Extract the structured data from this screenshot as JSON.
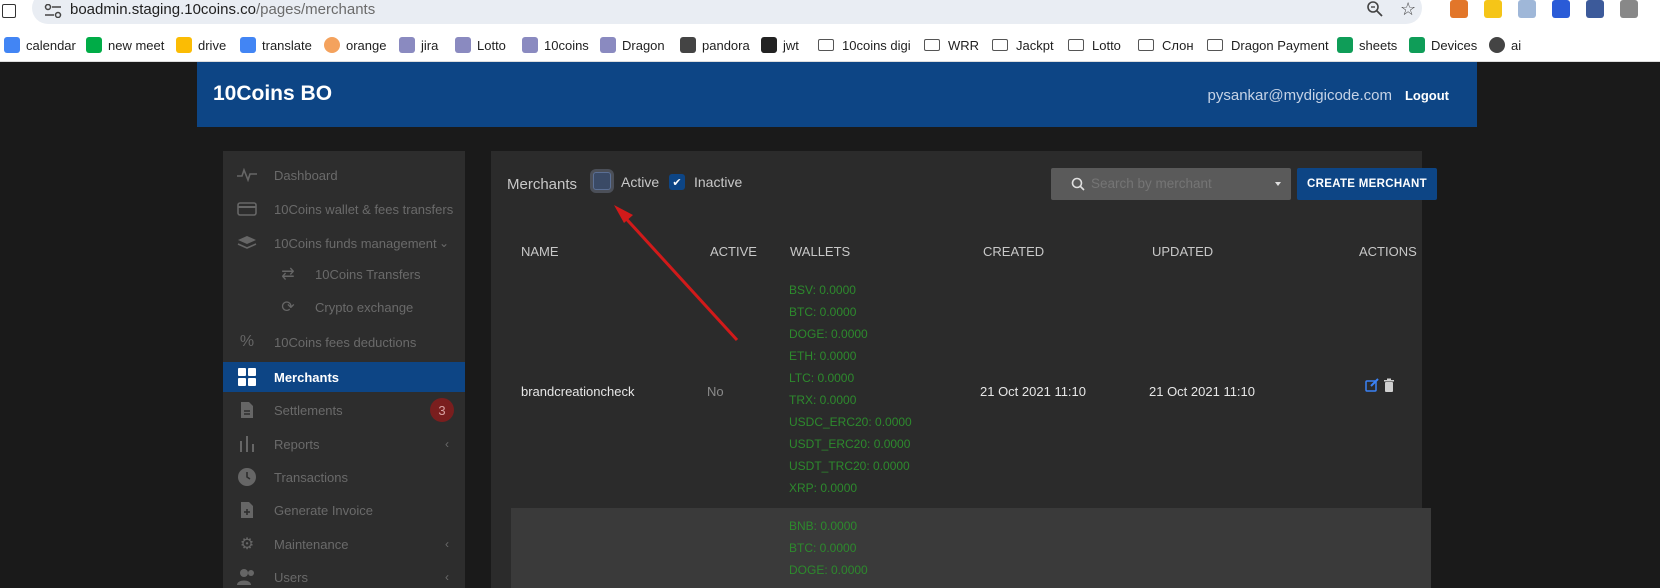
{
  "browser": {
    "url_host": "boadmin.staging.10coins.co",
    "url_path": "/pages/merchants",
    "bookmarks": [
      {
        "label": "calendar",
        "icon": "calendar-icon",
        "color": "#4285f4"
      },
      {
        "label": "new meet",
        "icon": "meet-icon",
        "color": "#00ac47"
      },
      {
        "label": "drive",
        "icon": "drive-icon",
        "color": "#fbbc04"
      },
      {
        "label": "translate",
        "icon": "translate-icon",
        "color": "#4285f4"
      },
      {
        "label": "orange",
        "icon": "orange-icon",
        "color": "#f4a25d"
      },
      {
        "label": "jira",
        "icon": "jira-icon",
        "color": "#8a8ac0"
      },
      {
        "label": "Lotto",
        "icon": "lotto-icon",
        "color": "#8a8ac0"
      },
      {
        "label": "10coins",
        "icon": "10coins-icon",
        "color": "#8a8ac0"
      },
      {
        "label": "Dragon",
        "icon": "dragon-icon",
        "color": "#8a8ac0"
      },
      {
        "label": "pandora",
        "icon": "lock-icon",
        "color": "#444444"
      },
      {
        "label": "jwt",
        "icon": "jwt-icon",
        "color": "#222222"
      },
      {
        "label": "10coins digi",
        "icon": "folder-icon"
      },
      {
        "label": "WRR",
        "icon": "folder-icon"
      },
      {
        "label": "Jackpt",
        "icon": "folder-icon"
      },
      {
        "label": "Lotto",
        "icon": "folder-icon"
      },
      {
        "label": "Слон",
        "icon": "folder-icon"
      },
      {
        "label": "Dragon Payment",
        "icon": "folder-icon"
      },
      {
        "label": "sheets",
        "icon": "sheets-icon",
        "color": "#0f9d58"
      },
      {
        "label": "Devices",
        "icon": "sheets-icon",
        "color": "#0f9d58"
      },
      {
        "label": "ai",
        "icon": "openai-icon",
        "color": "#444444"
      }
    ]
  },
  "header": {
    "brand": "10Coins BO",
    "user_email": "pysankar@mydigicode.com",
    "logout_label": "Logout"
  },
  "sidebar": {
    "items": [
      {
        "label": "Dashboard",
        "icon": "pulse-icon"
      },
      {
        "label": "10Coins wallet & fees transfers",
        "icon": "card-icon"
      },
      {
        "label": "10Coins funds management",
        "icon": "layers-icon"
      },
      {
        "label": "10Coins Transfers",
        "icon": "transfer-icon"
      },
      {
        "label": "Crypto exchange",
        "icon": "refresh-icon"
      },
      {
        "label": "10Coins fees deductions",
        "icon": "percent-icon"
      },
      {
        "label": "Merchants",
        "icon": "grid-icon"
      },
      {
        "label": "Settlements",
        "icon": "document-icon",
        "badge": "3"
      },
      {
        "label": "Reports",
        "icon": "bars-icon"
      },
      {
        "label": "Transactions",
        "icon": "clock-icon"
      },
      {
        "label": "Generate Invoice",
        "icon": "file-plus-icon"
      },
      {
        "label": "Maintenance",
        "icon": "gear-icon"
      },
      {
        "label": "Users",
        "icon": "users-icon"
      }
    ]
  },
  "main": {
    "title": "Merchants",
    "filter_active_label": "Active",
    "filter_inactive_label": "Inactive",
    "filter_active_checked": false,
    "filter_inactive_checked": true,
    "search_placeholder": "Search by merchant",
    "create_button": "CREATE MERCHANT",
    "columns": [
      "NAME",
      "ACTIVE",
      "WALLETS",
      "CREATED",
      "UPDATED",
      "ACTIONS"
    ],
    "rows": [
      {
        "name": "brandcreationcheck",
        "active": "No",
        "wallets": [
          "BSV: 0.0000",
          "BTC: 0.0000",
          "DOGE: 0.0000",
          "ETH: 0.0000",
          "LTC: 0.0000",
          "TRX: 0.0000",
          "USDC_ERC20: 0.0000",
          "USDT_ERC20: 0.0000",
          "USDT_TRC20: 0.0000",
          "XRP: 0.0000"
        ],
        "created": "21 Oct 2021 11:10",
        "updated": "21 Oct 2021 11:10"
      },
      {
        "wallets": [
          "BNB: 0.0000",
          "BTC: 0.0000",
          "DOGE: 0.0000"
        ]
      }
    ]
  },
  "colors": {
    "accent": "#0d4585",
    "wallet_green": "#2d8a2d",
    "annotation_arrow": "#d11a1a"
  }
}
